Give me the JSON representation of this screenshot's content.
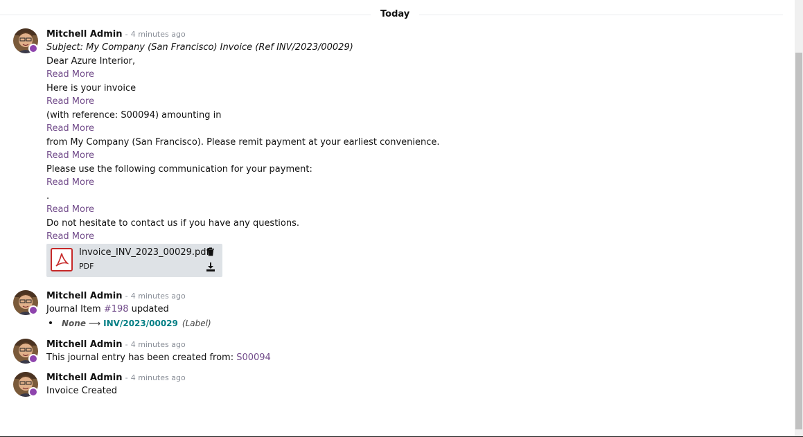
{
  "separator": {
    "label": "Today"
  },
  "messages": [
    {
      "author": "Mitchell Admin",
      "dash": "-",
      "date": "4 minutes ago",
      "subject": "Subject: My Company (San Francisco) Invoice (Ref INV/2023/00029)",
      "lines": [
        "Dear Azure Interior,",
        "Here is your invoice",
        "(with reference: S00094) amounting in",
        "from My Company (San Francisco). Please remit payment at your earliest convenience.",
        "Please use the following communication for your payment:",
        ".",
        "Do not hesitate to contact us if you have any questions."
      ],
      "read_more": "Read More",
      "attachment": {
        "name": "Invoice_INV_2023_00029.pdf",
        "type": "PDF"
      }
    },
    {
      "author": "Mitchell Admin",
      "dash": "-",
      "date": "4 minutes ago",
      "body_prefix": "Journal Item ",
      "body_link": "#198",
      "body_suffix": " updated",
      "tracking": {
        "old": "None",
        "arrow": "⟶",
        "new": "INV/2023/00029",
        "field": "(Label)"
      }
    },
    {
      "author": "Mitchell Admin",
      "dash": "-",
      "date": "4 minutes ago",
      "body_prefix": "This journal entry has been created from: ",
      "body_link": "S00094"
    },
    {
      "author": "Mitchell Admin",
      "dash": "-",
      "date": "4 minutes ago",
      "body": "Invoice Created"
    }
  ],
  "colors": {
    "accent": "#714b8a",
    "presence": "#8e44ad",
    "tracking_value": "#017e84",
    "pdf_red": "#c62828"
  },
  "icons": {
    "attachment_file": "pdf-icon",
    "delete": "trash-icon",
    "download": "download-icon"
  }
}
